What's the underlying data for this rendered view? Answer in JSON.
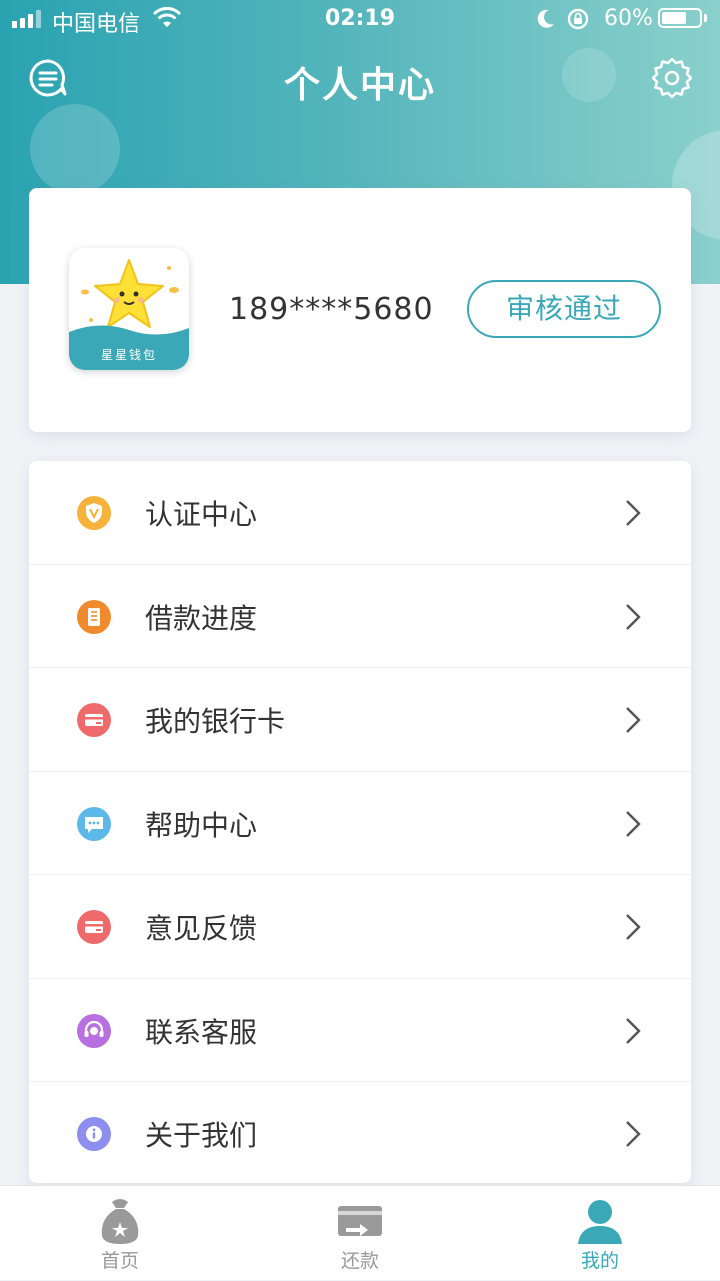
{
  "status_bar": {
    "carrier": "中国电信",
    "time": "02:19",
    "battery": "60%"
  },
  "header": {
    "title": "个人中心",
    "message_icon": "message-icon",
    "settings_icon": "gear-icon"
  },
  "profile": {
    "logo_text": "星星钱包",
    "phone": "189****5680",
    "status_label": "审核通过"
  },
  "menu": {
    "items": [
      {
        "label": "认证中心",
        "icon": "shield-v-icon",
        "color": "#f7b23b"
      },
      {
        "label": "借款进度",
        "icon": "progress-icon",
        "color": "#f08a2c"
      },
      {
        "label": "我的银行卡",
        "icon": "bank-card-icon",
        "color": "#ef6a6a"
      },
      {
        "label": "帮助中心",
        "icon": "chat-icon",
        "color": "#5cb8e8"
      },
      {
        "label": "意见反馈",
        "icon": "feedback-icon",
        "color": "#ef6a6a"
      },
      {
        "label": "联系客服",
        "icon": "headset-icon",
        "color": "#b86fe0"
      },
      {
        "label": "关于我们",
        "icon": "info-icon",
        "color": "#8c8ef0"
      }
    ]
  },
  "tabbar": {
    "tabs": [
      {
        "label": "首页",
        "icon": "money-bag-icon",
        "active": false
      },
      {
        "label": "还款",
        "icon": "card-transfer-icon",
        "active": false
      },
      {
        "label": "我的",
        "icon": "user-icon",
        "active": true
      }
    ]
  },
  "colors": {
    "accent": "#3aa8b7",
    "header_start": "#2aa3b1",
    "header_end": "#8ad0cc",
    "inactive_tab": "#999999"
  }
}
